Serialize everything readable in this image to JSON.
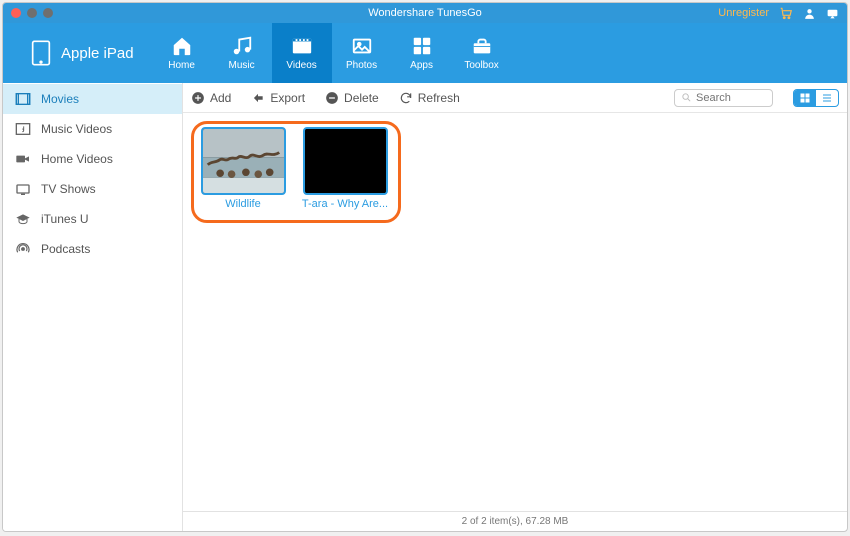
{
  "title": "Wondershare TunesGo",
  "registration": {
    "label": "Unregister"
  },
  "device": {
    "name": "Apple iPad"
  },
  "nav": {
    "items": [
      {
        "label": "Home",
        "active": false
      },
      {
        "label": "Music",
        "active": false
      },
      {
        "label": "Videos",
        "active": true
      },
      {
        "label": "Photos",
        "active": false
      },
      {
        "label": "Apps",
        "active": false
      },
      {
        "label": "Toolbox",
        "active": false
      }
    ]
  },
  "sidebar": {
    "items": [
      {
        "label": "Movies",
        "active": true
      },
      {
        "label": "Music Videos",
        "active": false
      },
      {
        "label": "Home Videos",
        "active": false
      },
      {
        "label": "TV Shows",
        "active": false
      },
      {
        "label": "iTunes U",
        "active": false
      },
      {
        "label": "Podcasts",
        "active": false
      }
    ]
  },
  "toolbar": {
    "add_label": "Add",
    "export_label": "Export",
    "delete_label": "Delete",
    "refresh_label": "Refresh"
  },
  "search": {
    "placeholder": "Search"
  },
  "content": {
    "items": [
      {
        "title": "Wildlife",
        "thumb_style": "wildlife"
      },
      {
        "title": "T-ara - Why Are...",
        "thumb_style": "black"
      }
    ]
  },
  "status": {
    "text": "2 of 2 item(s), 67.28 MB"
  }
}
